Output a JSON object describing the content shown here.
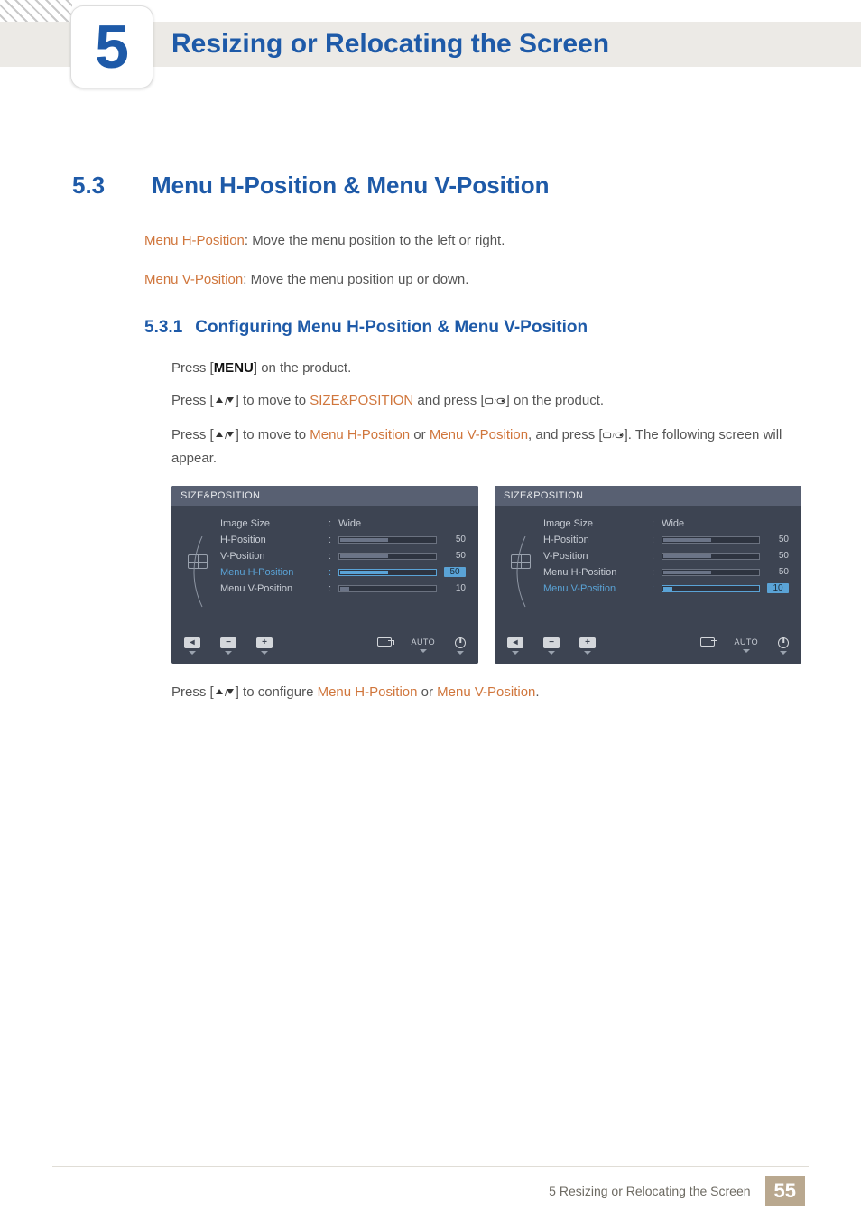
{
  "chapter": {
    "number": "5",
    "title": "Resizing or Relocating the Screen"
  },
  "section": {
    "number": "5.3",
    "title": "Menu H-Position & Menu V-Position"
  },
  "paragraphs": {
    "p1_label": "Menu H-Position",
    "p1_text": ": Move the menu position to the left or right.",
    "p2_label": "Menu V-Position",
    "p2_text": ": Move the menu position up or down."
  },
  "subsection": {
    "number": "5.3.1",
    "title": "Configuring Menu H-Position & Menu V-Position"
  },
  "steps": {
    "s1_a": "Press [",
    "s1_menu": "MENU",
    "s1_b": "] on the product.",
    "s2_a": "Press [",
    "s2_b": "] to move to ",
    "s2_hl": "SIZE&POSITION",
    "s2_c": " and press [",
    "s2_d": "] on the product.",
    "s3_a": "Press [",
    "s3_b": "] to move to ",
    "s3_hl1": "Menu H-Position",
    "s3_or": " or ",
    "s3_hl2": "Menu V-Position",
    "s3_c": ", and press [",
    "s3_d": "]. The following screen will appear.",
    "s4_a": "Press [",
    "s4_b": "] to configure ",
    "s4_hl1": "Menu H-Position",
    "s4_or": " or ",
    "s4_hl2": "Menu V-Position",
    "s4_c": "."
  },
  "osd": {
    "title": "SIZE&POSITION",
    "labels": {
      "image_size": "Image Size",
      "h_pos": "H-Position",
      "v_pos": "V-Position",
      "menu_h": "Menu H-Position",
      "menu_v": "Menu V-Position"
    },
    "image_size_value": "Wide",
    "values": {
      "h_pos": "50",
      "v_pos": "50",
      "menu_h": "50",
      "menu_v": "10"
    },
    "footer": {
      "auto": "AUTO"
    }
  },
  "footer": {
    "text": "5 Resizing or Relocating the Screen",
    "page": "55"
  }
}
